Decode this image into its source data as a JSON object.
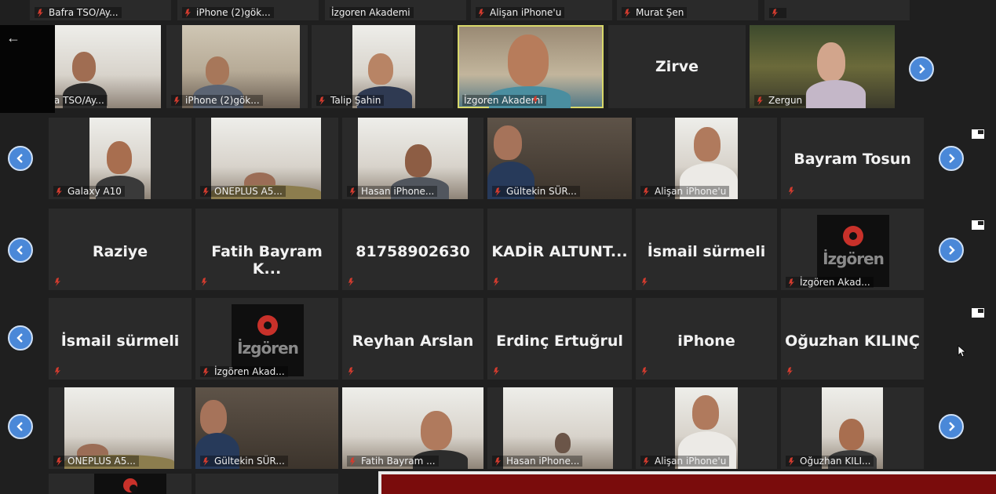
{
  "top_strip": [
    "Bafra TSO/Ay...",
    "iPhone (2)gök...",
    "İzgoren Akademi",
    "Alişan iPhone'u",
    "Murat Şen",
    ""
  ],
  "row1": [
    {
      "label": "ra TSO/Ay..."
    },
    {
      "label": "iPhone (2)gök..."
    },
    {
      "label": "Talip Şahin"
    },
    {
      "label": "İzgoren Akademi"
    },
    {
      "name": "Zirve",
      "label": ""
    },
    {
      "label": "Zergun"
    }
  ],
  "row2": [
    {
      "label": "Galaxy A10"
    },
    {
      "label": "ONEPLUS A5..."
    },
    {
      "label": "Hasan iPhone..."
    },
    {
      "label": "Gültekin SÜR..."
    },
    {
      "label": "Alişan iPhone'u"
    },
    {
      "name": "Bayram Tosun",
      "label": ""
    }
  ],
  "row3": [
    {
      "name": "Raziye",
      "label": ""
    },
    {
      "name": "Fatih  Bayram  K...",
      "label": ""
    },
    {
      "name": "81758902630",
      "label": ""
    },
    {
      "name": "KADİR  ALTUNT...",
      "label": ""
    },
    {
      "name": "İsmail sürmeli",
      "label": ""
    },
    {
      "label": "İzgören Akad..."
    }
  ],
  "row4": [
    {
      "name": "İsmail sürmeli",
      "label": ""
    },
    {
      "label": "İzgören Akad..."
    },
    {
      "name": "Reyhan Arslan",
      "label": ""
    },
    {
      "name": "Erdinç Ertuğrul",
      "label": ""
    },
    {
      "name": "iPhone",
      "label": ""
    },
    {
      "name": "Oğuzhan KILINÇ",
      "label": ""
    }
  ],
  "row5": [
    {
      "label": "ONEPLUS A5..."
    },
    {
      "label": "Gültekin SÜR..."
    },
    {
      "label": "Fatih Bayram ..."
    },
    {
      "label": "Hasan iPhone..."
    },
    {
      "label": "Alişan iPhone'u"
    },
    {
      "label": "Oğuzhan KILI..."
    }
  ],
  "logo_text": "İzgören",
  "colors": {
    "background": "#1f1f1f",
    "tile": "#2a2a2a",
    "nav_button": "#4a88d8",
    "muted_mic": "#d23b2e",
    "banner": "#7a0c0c"
  },
  "icons": {
    "back": "←",
    "prev": "chevron-left-icon",
    "next": "chevron-right-icon",
    "muted": "muted-mic-icon"
  }
}
